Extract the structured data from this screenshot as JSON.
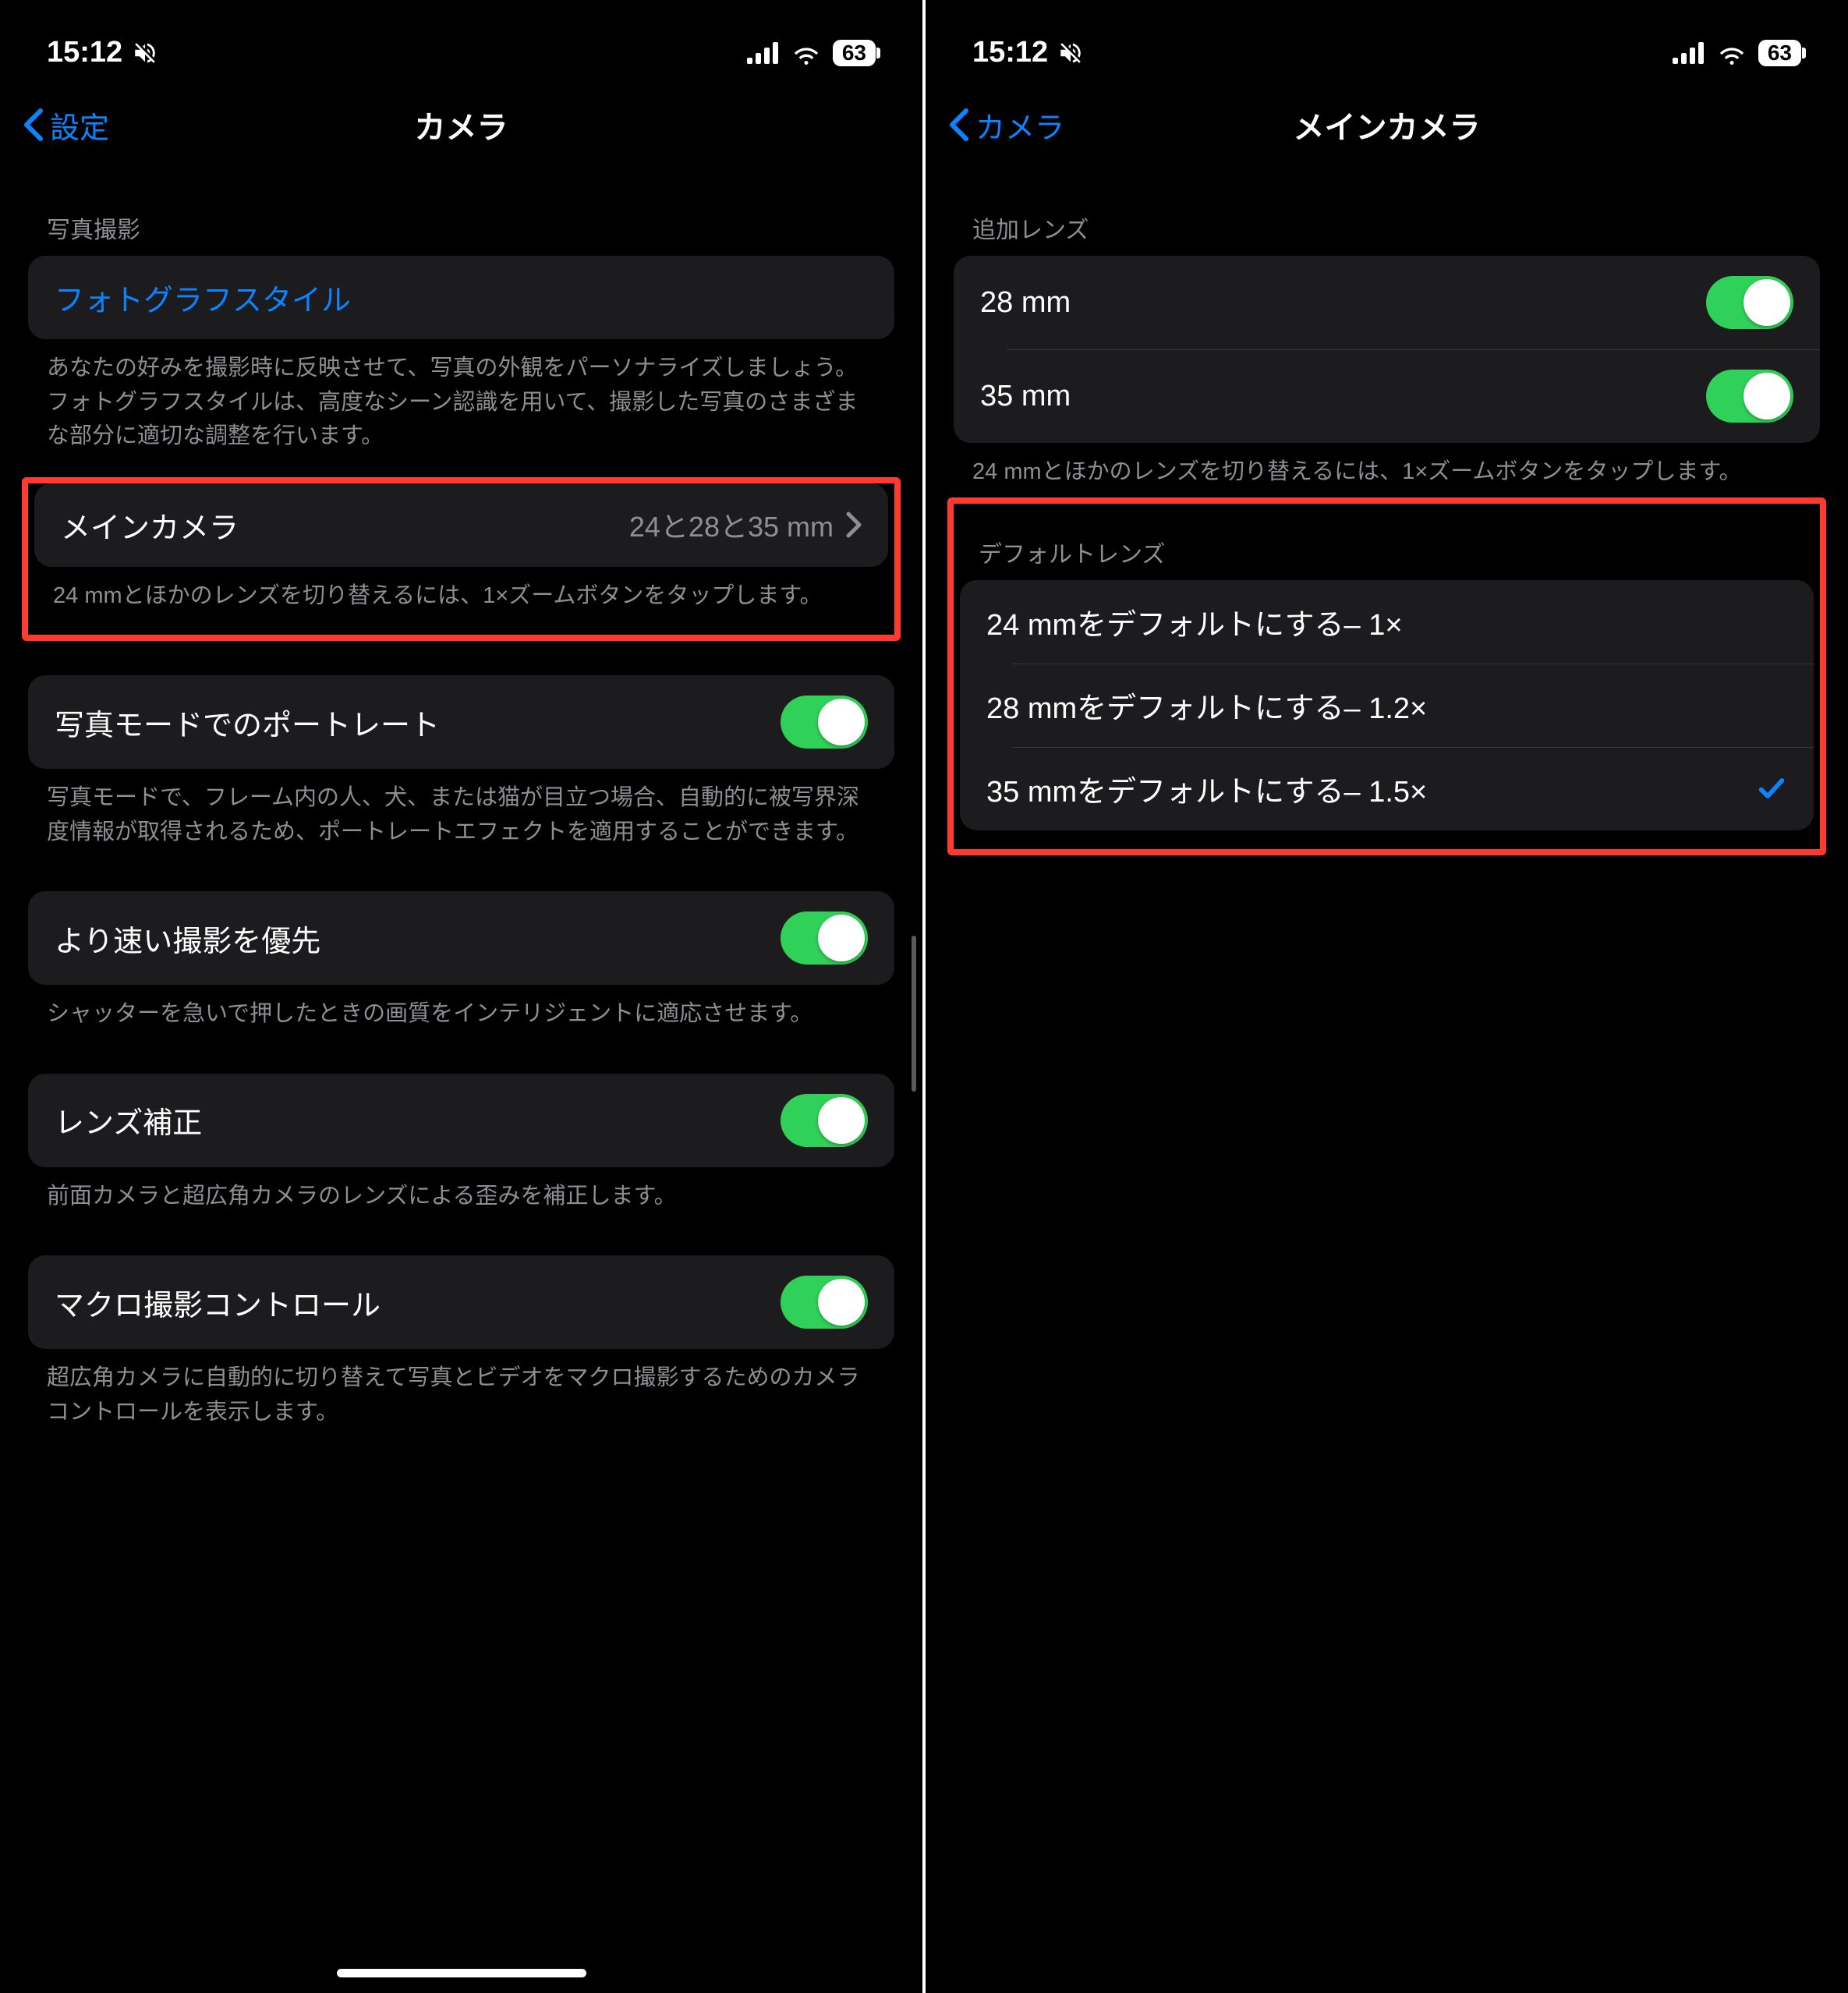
{
  "status": {
    "time": "15:12",
    "battery": "63"
  },
  "left": {
    "back": "設定",
    "title": "カメラ",
    "section1_header": "写真撮影",
    "photographic_styles": "フォトグラフスタイル",
    "photographic_styles_footer": "あなたの好みを撮影時に反映させて、写真の外観をパーソナライズしましょう。フォトグラフスタイルは、高度なシーン認識を用いて、撮影した写真のさまざまな部分に適切な調整を行います。",
    "main_camera_label": "メインカメラ",
    "main_camera_value": "24と28と35 mm",
    "main_camera_footer": "24 mmとほかのレンズを切り替えるには、1×ズームボタンをタップします。",
    "portrait_label": "写真モードでのポートレート",
    "portrait_footer": "写真モードで、フレーム内の人、犬、または猫が目立つ場合、自動的に被写界深度情報が取得されるため、ポートレートエフェクトを適用することができます。",
    "faster_label": "より速い撮影を優先",
    "faster_footer": "シャッターを急いで押したときの画質をインテリジェントに適応させます。",
    "lens_label": "レンズ補正",
    "lens_footer": "前面カメラと超広角カメラのレンズによる歪みを補正します。",
    "macro_label": "マクロ撮影コントロール",
    "macro_footer": "超広角カメラに自動的に切り替えて写真とビデオをマクロ撮影するためのカメラコントロールを表示します。"
  },
  "right": {
    "back": "カメラ",
    "title": "メインカメラ",
    "section1_header": "追加レンズ",
    "lens28": "28 mm",
    "lens35": "35 mm",
    "section1_footer": "24 mmとほかのレンズを切り替えるには、1×ズームボタンをタップします。",
    "section2_header": "デフォルトレンズ",
    "default24": "24 mmをデフォルトにする– 1×",
    "default28": "28 mmをデフォルトにする– 1.2×",
    "default35": "35 mmをデフォルトにする– 1.5×"
  }
}
